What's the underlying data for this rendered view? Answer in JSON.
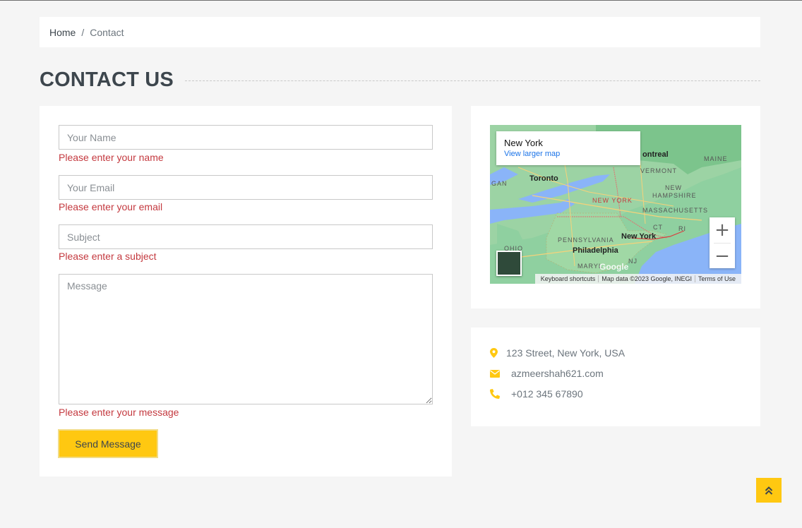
{
  "breadcrumb": {
    "home": "Home",
    "separator": "/",
    "current": "Contact"
  },
  "title": "CONTACT US",
  "form": {
    "name_placeholder": "Your Name",
    "name_error": "Please enter your name",
    "email_placeholder": "Your Email",
    "email_error": "Please enter your email",
    "subject_placeholder": "Subject",
    "subject_error": "Please enter a subject",
    "message_placeholder": "Message",
    "message_error": "Please enter your message",
    "send_label": "Send Message"
  },
  "map": {
    "place": "New York",
    "larger_map_link": "View larger map",
    "zoom_in": "+",
    "zoom_out": "−",
    "attribution": [
      "Keyboard shortcuts",
      "Map data ©2023 Google, INEGI",
      "Terms of Use"
    ],
    "logo": "Google",
    "labels": {
      "toronto": "Toronto",
      "montreal": "ontreal",
      "maine": "MAINE",
      "vermont": "VERMONT",
      "nh": "NEW HAMPSHIRE",
      "ny_state": "NEW YORK",
      "mass": "MASSACHUSETTS",
      "ct": "CT",
      "ri": "RI",
      "ny_city": "New York",
      "penn": "PENNSYLVANIA",
      "phil": "Philadelphia",
      "nj": "NJ",
      "maryland": "MARYL",
      "ohio": "OHIO",
      "gan": "GAN"
    }
  },
  "contact": {
    "address": "123 Street, New York, USA",
    "email": "azmeershah621.com",
    "phone": "+012 345 67890"
  },
  "colors": {
    "accent": "#ffc811",
    "error": "#c4393f",
    "heading": "#3d464d"
  },
  "icons": {
    "address": "map-marker-icon",
    "email": "envelope-icon",
    "phone": "phone-icon",
    "back_to_top": "double-chevron-up-icon"
  }
}
